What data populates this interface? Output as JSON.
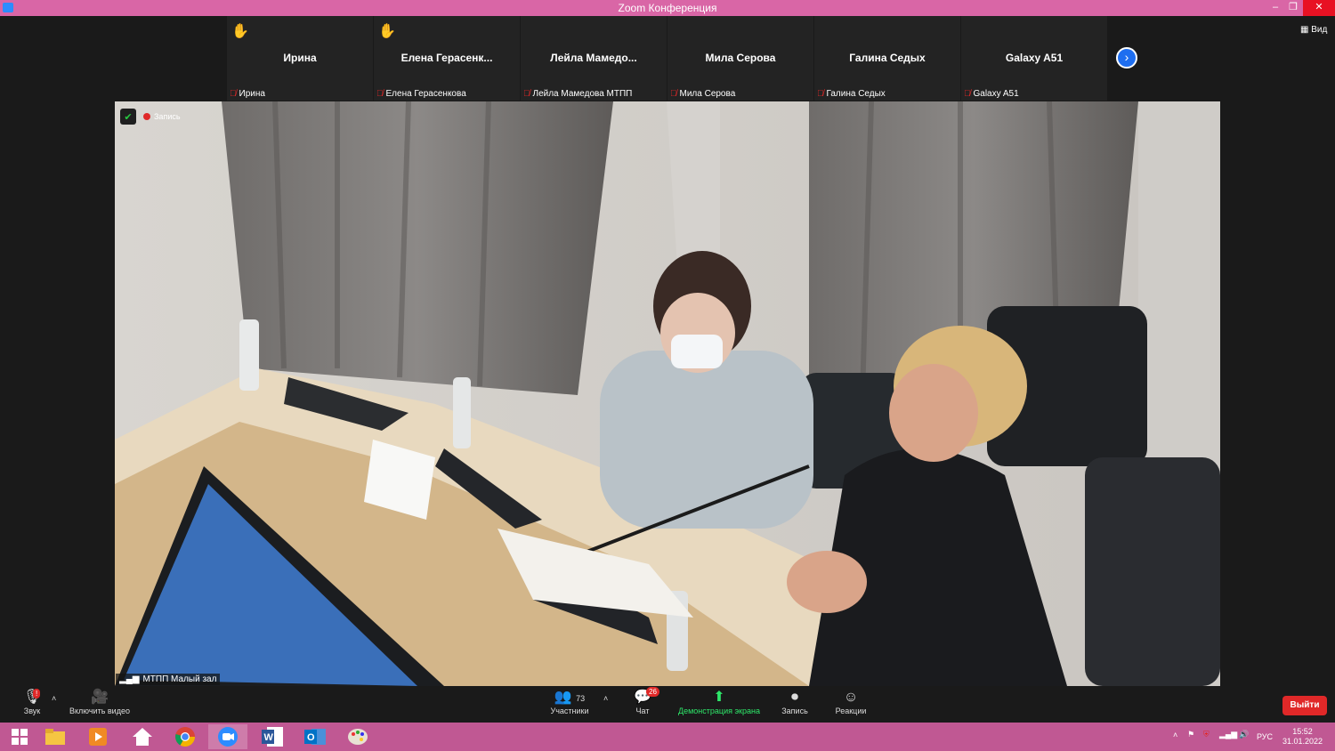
{
  "window": {
    "title": "Zoom Конференция",
    "minimize": "–",
    "restore": "❐",
    "close": "✕"
  },
  "gallery": {
    "tiles": [
      {
        "name": "Ирина",
        "footer": "Ирина",
        "hand_raised": true
      },
      {
        "name": "Елена  Герасенк...",
        "footer": "Елена Герасенкова",
        "hand_raised": true
      },
      {
        "name": "Лейла  Мамедо...",
        "footer": "Лейла Мамедова МТПП",
        "hand_raised": false
      },
      {
        "name": "Мила Серова",
        "footer": "Мила Серова",
        "hand_raised": false
      },
      {
        "name": "Галина Седых",
        "footer": "Галина Седых",
        "hand_raised": false
      },
      {
        "name": "Galaxy A51",
        "footer": "Galaxy A51",
        "hand_raised": false
      }
    ],
    "next_icon": "chevron-right-icon",
    "view_label": "Вид"
  },
  "video": {
    "recording_label": "Запись",
    "speaker_label": "МТПП Малый зал"
  },
  "toolbar": {
    "audio_label": "Звук",
    "video_label": "Включить видео",
    "participants_count": "73",
    "participants_label": "Участники",
    "chat_label": "Чат",
    "chat_badge": "26",
    "share_label": "Демонстрация экрана",
    "record_label": "Запись",
    "reactions_label": "Реакции",
    "leave_label": "Выйти"
  },
  "taskbar": {
    "apps": [
      "windows-start",
      "file-explorer",
      "media-player",
      "home",
      "chrome",
      "zoom",
      "word",
      "outlook",
      "paint"
    ],
    "active_app": "zoom",
    "language": "РУС",
    "time": "15:52",
    "date": "31.01.2022"
  },
  "colors": {
    "titlebar": "#d966a6",
    "taskbar": "#c05893",
    "accent": "#2d8cff",
    "leave": "#e02828",
    "share": "#2ee86a"
  }
}
